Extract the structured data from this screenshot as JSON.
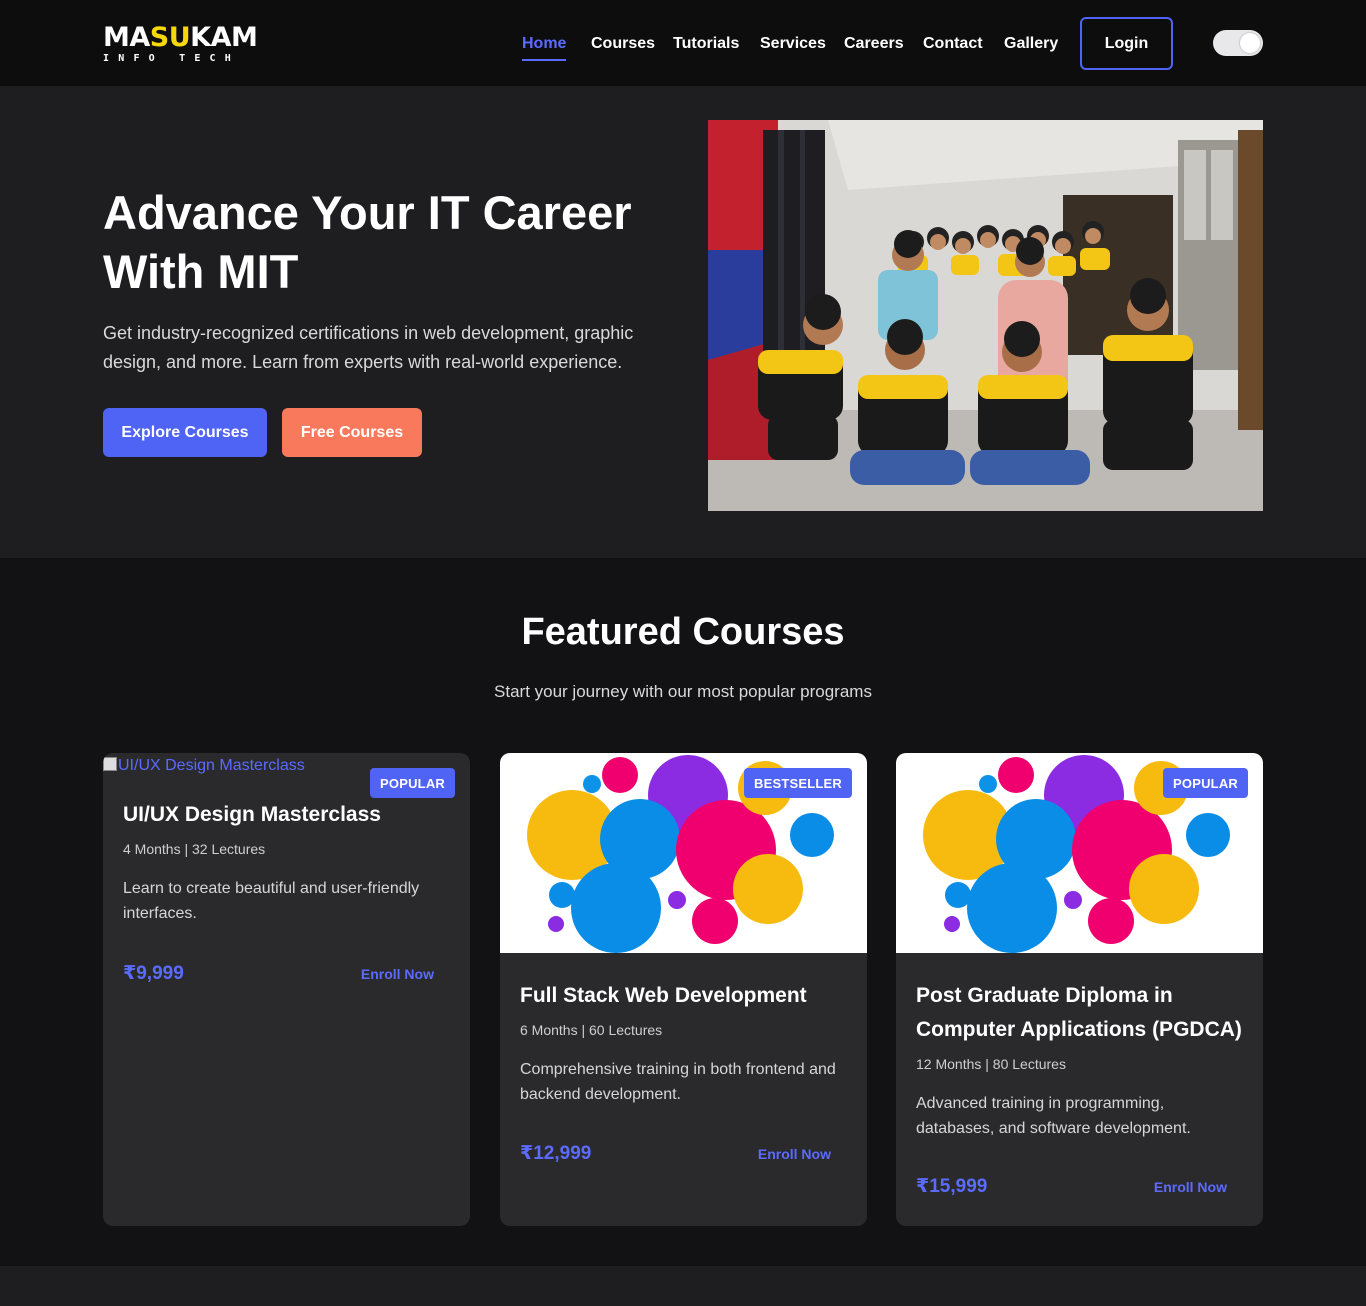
{
  "brand": {
    "logo_main_a": "MA",
    "logo_main_b": "SU",
    "logo_main_c": "KAM",
    "logo_sub": "INFO TECH"
  },
  "nav": {
    "items": [
      {
        "label": "Home",
        "active": true
      },
      {
        "label": "Courses"
      },
      {
        "label": "Tutorials"
      },
      {
        "label": "Services"
      },
      {
        "label": "Careers"
      },
      {
        "label": "Contact"
      },
      {
        "label": "Gallery"
      }
    ],
    "login_label": "Login",
    "accent_color": "#4f63f5"
  },
  "hero": {
    "title_line1": "Advance Your IT Career",
    "title_line2": "With MIT",
    "subtitle": "Get industry-recognized certifications in web development, graphic design, and more. Learn from experts with real-world experience.",
    "primary_button": "Explore Courses",
    "secondary_button": "Free Courses",
    "secondary_color": "#f9795c"
  },
  "featured": {
    "title": "Featured Courses",
    "subtitle": "Start your journey with our most popular programs"
  },
  "courses": [
    {
      "image_alt": "UI/UX Design Masterclass",
      "badge": "POPULAR",
      "title": "UI/UX Design Masterclass",
      "meta": "4 Months | 32 Lectures",
      "description": "Learn to create beautiful and user-friendly interfaces.",
      "price": "₹9,999",
      "cta": "Enroll Now"
    },
    {
      "badge": "BESTSELLER",
      "title": "Full Stack Web Development",
      "meta": "6 Months | 60 Lectures",
      "description": "Comprehensive training in both frontend and backend development.",
      "price": "₹12,999",
      "cta": "Enroll Now"
    },
    {
      "badge": "POPULAR",
      "title": "Post Graduate Diploma in Computer Applications (PGDCA)",
      "meta": "12 Months | 80 Lectures",
      "description": "Advanced training in programming, databases, and software development.",
      "price": "₹15,999",
      "cta": "Enroll Now"
    }
  ]
}
